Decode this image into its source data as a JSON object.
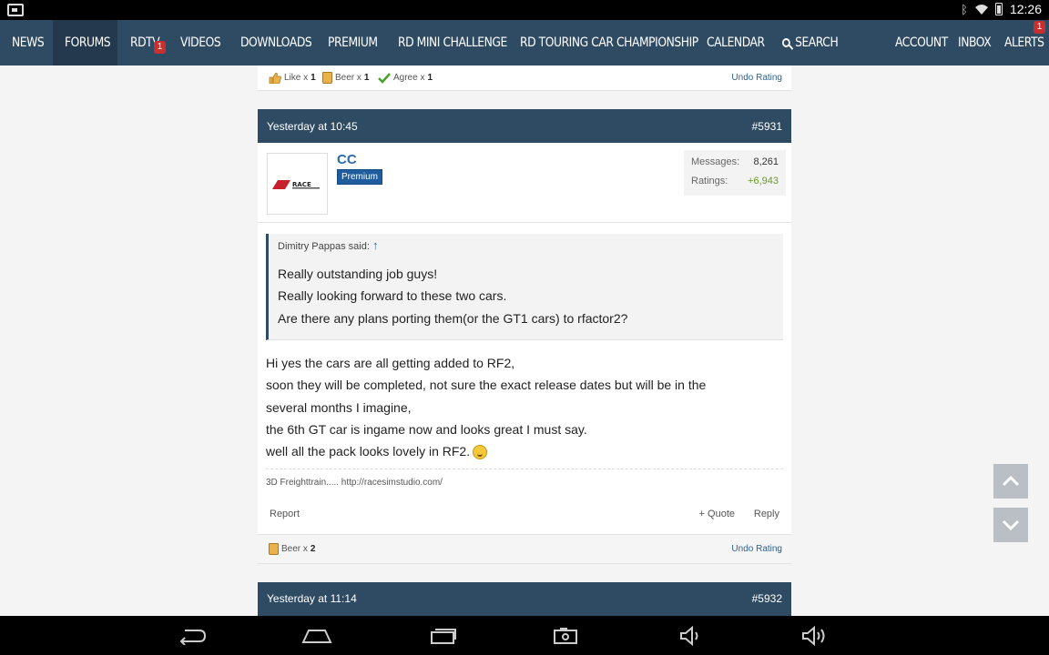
{
  "status_bar": {
    "time": "12:26",
    "bluetooth_icon": "bluetooth-icon",
    "wifi_icon": "wifi-icon",
    "battery_icon": "battery-icon"
  },
  "nav": {
    "items": [
      {
        "label": "NEWS"
      },
      {
        "label": "FORUMS"
      },
      {
        "label": "RDTV",
        "badge": "1"
      },
      {
        "label": "VIDEOS"
      },
      {
        "label": "DOWNLOADS"
      },
      {
        "label": "PREMIUM"
      },
      {
        "label": "RD MINI CHALLENGE"
      },
      {
        "label": "RD TOURING CAR CHAMPIONSHIP"
      },
      {
        "label": "CALENDAR"
      },
      {
        "label": "SEARCH"
      },
      {
        "label": "ACCOUNT"
      },
      {
        "label": "INBOX"
      },
      {
        "label": "ALERTS",
        "badge": "1"
      }
    ]
  },
  "top_ratings": {
    "like": {
      "label": "Like x",
      "count": "1"
    },
    "beer": {
      "label": "Beer x",
      "count": "1"
    },
    "agree": {
      "label": "Agree x",
      "count": "1"
    },
    "undo": "Undo Rating"
  },
  "post": {
    "date": "Yesterday at 10:45",
    "number": "#5931",
    "username": "CC",
    "user_title": "Premium",
    "avatar_text": "RACE",
    "stats": {
      "messages_label": "Messages:",
      "messages": "8,261",
      "ratings_label": "Ratings:",
      "ratings": "+6,943"
    },
    "quote": {
      "author": "Dimitry Pappas said:",
      "arrow": "↑",
      "lines": [
        "Really outstanding job guys!",
        "Really looking forward to these two cars.",
        "Are there any plans porting them(or the GT1 cars) to rfactor2?"
      ]
    },
    "message_lines": [
      "Hi yes the cars are all getting added to RF2,",
      "soon they will be completed, not sure the exact release dates but will be in the",
      "several months I imagine,",
      "the 6th GT car is ingame now and looks great I must say.",
      "well all the pack looks lovely in RF2."
    ],
    "signature": "3D Freighttrain..... http://racesimstudio.com/",
    "report": "Report",
    "quote_link": "+ Quote",
    "reply": "Reply",
    "rating": {
      "label": "Beer x",
      "count": "2"
    },
    "undo": "Undo Rating"
  },
  "next_post": {
    "date": "Yesterday at 11:14",
    "number": "#5932"
  },
  "colors": {
    "nav_bg": "#2f4b63",
    "accent_link": "#2a6bb0",
    "ratings_green": "#6a9a26",
    "badge_red": "#c8302f"
  }
}
